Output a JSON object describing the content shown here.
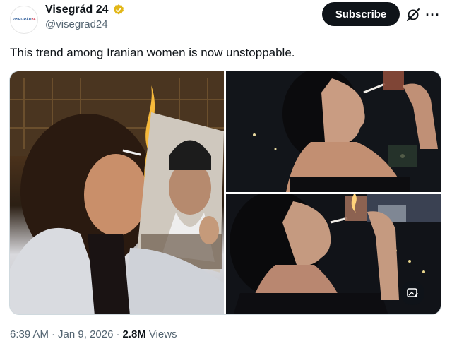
{
  "account": {
    "avatar_text_blue": "VISEGRÁD",
    "avatar_text_red": "24",
    "display_name": "Visegrád 24",
    "handle": "@visegrad24",
    "verified_color": "#e2b719"
  },
  "actions": {
    "subscribe_label": "Subscribe",
    "grok_icon": "grok-icon",
    "more_label": "···"
  },
  "tweet": {
    "text": "This trend among Iranian women is now unstoppable."
  },
  "media": {
    "photos": [
      {
        "name": "photo-woman-burning-portrait"
      },
      {
        "name": "photo-woman-smoking-night"
      },
      {
        "name": "photo-woman-lighting-cigarette"
      }
    ],
    "alt_icon": "image-edit-icon"
  },
  "footer": {
    "time": "6:39 AM",
    "sep1": "·",
    "date": "Jan 9, 2026",
    "sep2": "·",
    "views_count": "2.8M",
    "views_label": "Views"
  }
}
